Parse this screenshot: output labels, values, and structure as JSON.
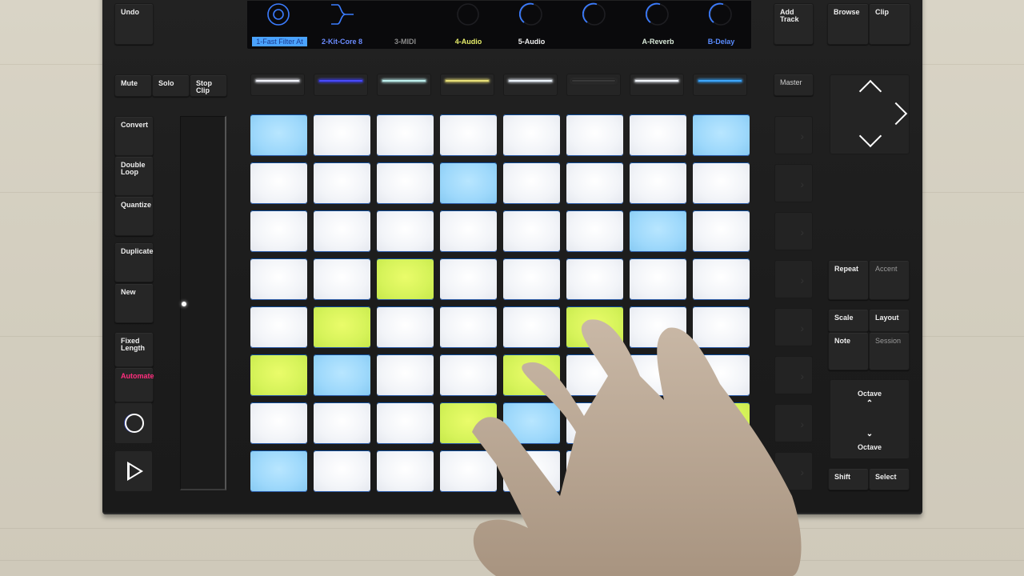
{
  "left_buttons": {
    "undo": "Undo",
    "mute": "Mute",
    "solo": "Solo",
    "stop_clip": "Stop\nClip",
    "convert": "Convert",
    "double_loop": "Double\nLoop",
    "quantize": "Quantize",
    "duplicate": "Duplicate",
    "new": "New",
    "fixed_length": "Fixed\nLength",
    "automate": "Automate"
  },
  "transport": {
    "record_icon": "record-circle-icon",
    "play_icon": "play-triangle-icon"
  },
  "display": {
    "tracks": [
      {
        "label": "1-Fast Filter At",
        "icon": "knob-double-ring",
        "label_color": "#1a3a8c",
        "selected": true
      },
      {
        "label": "2-Kit-Core 8",
        "icon": "drum-rack-split",
        "label_color": "#6b8cff",
        "prefix_icon": "grid-icon",
        "selected": false
      },
      {
        "label": "3-MIDI",
        "icon": "empty",
        "label_color": "#8a8a8a",
        "selected": false
      },
      {
        "label": "4-Audio",
        "icon": "knob-off",
        "label_color": "#e8ef6a",
        "selected": false
      },
      {
        "label": "5-Audio",
        "icon": "knob",
        "label_color": "#f0f0f0",
        "selected": false
      },
      {
        "label": "",
        "icon": "knob",
        "label_color": "#f0f0f0",
        "selected": false
      },
      {
        "label": "A-Reverb",
        "icon": "knob",
        "label_color": "#d8e8d8",
        "selected": false
      },
      {
        "label": "B-Delay",
        "icon": "knob",
        "label_color": "#5a8cff",
        "selected": false
      }
    ],
    "accent_color": "#3b7cff"
  },
  "track_leds": [
    "#f4f6ff",
    "#4a4cff",
    "#bff0ee",
    "#e8e07a",
    "#eef6ff",
    "#3a3a3a",
    "#f4f8ff",
    "#3fa8ff"
  ],
  "pads": [
    [
      "B",
      "W",
      "W",
      "W",
      "W",
      "W",
      "W",
      "B"
    ],
    [
      "W",
      "W",
      "W",
      "B",
      "W",
      "W",
      "W",
      "W"
    ],
    [
      "W",
      "W",
      "W",
      "W",
      "W",
      "W",
      "B",
      "W"
    ],
    [
      "W",
      "W",
      "G",
      "W",
      "W",
      "W",
      "W",
      "W"
    ],
    [
      "W",
      "G",
      "W",
      "W",
      "W",
      "G",
      "W",
      "W"
    ],
    [
      "G",
      "B",
      "W",
      "W",
      "G",
      "W",
      "W",
      "W"
    ],
    [
      "W",
      "W",
      "W",
      "G",
      "B",
      "W",
      "W",
      "G"
    ],
    [
      "B",
      "W",
      "W",
      "W",
      "W",
      "W",
      "W",
      "W"
    ]
  ],
  "pad_colors": {
    "W": "#f2f4f8",
    "B": "#9dd8fb",
    "G": "#d6f35a"
  },
  "touch_strip": {
    "level": 0.5
  },
  "right_buttons": {
    "add_track": "Add\nTrack",
    "browse": "Browse",
    "clip": "Clip",
    "master": "Master",
    "repeat": "Repeat",
    "accent": "Accent",
    "scale": "Scale",
    "layout": "Layout",
    "note": "Note",
    "session": "Session",
    "octave_up": "Octave",
    "octave_down": "Octave",
    "shift": "Shift",
    "select": "Select"
  },
  "octave_arrows": {
    "up": "^",
    "down": "v"
  }
}
